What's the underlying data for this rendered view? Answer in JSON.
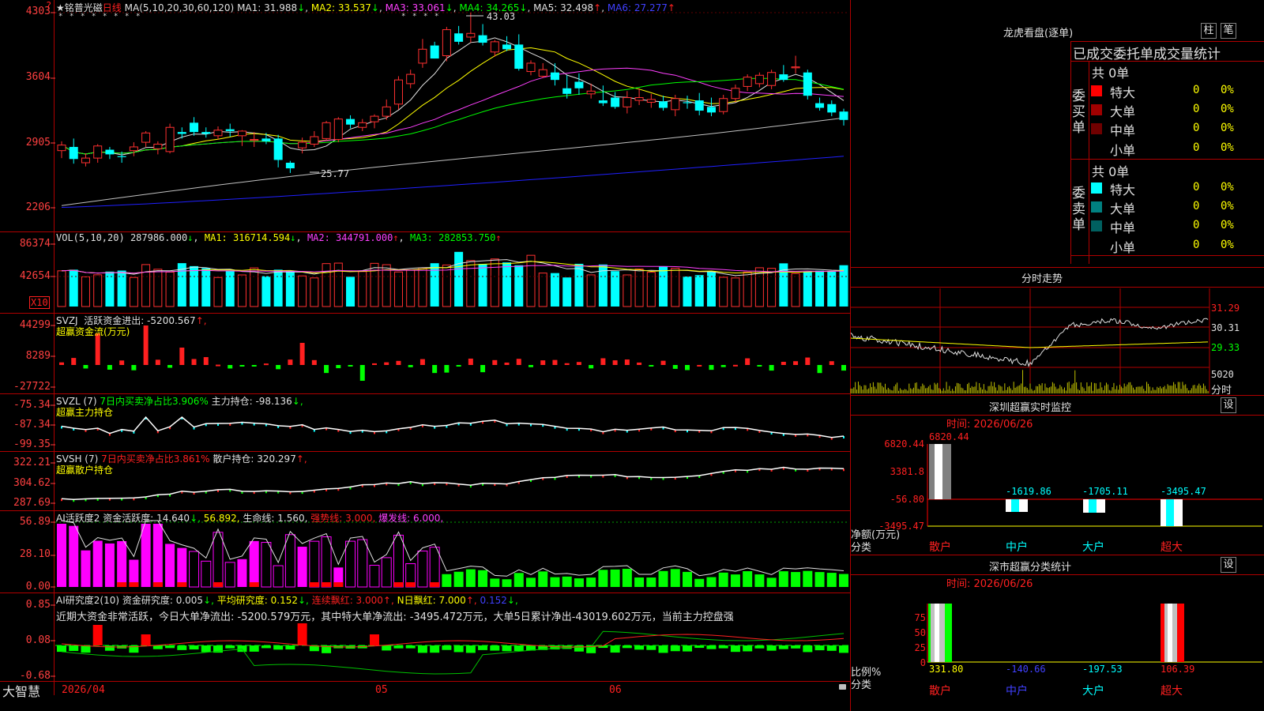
{
  "kline": {
    "star": "★",
    "stock_name": "铭普光磁",
    "period": "日线",
    "ma_params": "MA(5,10,20,30,60,120)",
    "ma1": "MA1: 31.988",
    "ma1_arrow": "↓",
    "ma2": "MA2: 33.537",
    "ma2_arrow": "↓",
    "ma3": "MA3: 33.061",
    "ma3_arrow": "↓",
    "ma4": "MA4: 34.265",
    "ma4_arrow": "↓",
    "ma5": "MA5: 32.498",
    "ma5_arrow": "↑",
    "ma6": "MA6: 27.277",
    "ma6_arrow": "↑",
    "high_mark": "43.03",
    "low_mark": "25.77",
    "y_labels": [
      "4303",
      "3604",
      "2905",
      "2206"
    ],
    "question_mark": "?"
  },
  "vol": {
    "title": "VOL(5,10,20)",
    "value": "287986.000",
    "value_arrow": "↓",
    "ma1": "MA1: 316714.594",
    "ma1_arrow": "↓",
    "ma2": "MA2: 344791.000",
    "ma2_arrow": "↑",
    "ma3": "MA3: 282853.750",
    "ma3_arrow": "↑",
    "y_labels": [
      "86374",
      "42654"
    ],
    "unit": "X10"
  },
  "svzj": {
    "title": "SVZJ",
    "label": "活跃资金进出: -5200.567",
    "arrow": "↑,",
    "subtitle": "超赢资金流(万元)",
    "y_labels": [
      "44299",
      "8289",
      "-27722"
    ]
  },
  "svzl": {
    "title": "SVZL (7)",
    "part1": "7日内买卖净占比3.906%",
    "part2": "主力持仓: -98.136",
    "arrow": "↓,",
    "subtitle": "超赢主力持仓",
    "y_labels": [
      "-75.34",
      "-87.34",
      "-99.35"
    ]
  },
  "svsh": {
    "title": "SVSH (7)",
    "part1": "7日内买卖净占比3.861%",
    "part2": "散户持仓: 320.297",
    "arrow": "↑,",
    "subtitle": "超赢散户持仓",
    "y_labels": [
      "322.21",
      "304.62",
      "287.69"
    ]
  },
  "ai_active": {
    "title": "AI活跃度2",
    "part1": "资金活跃度: 14.640",
    "arrow1": "↓,",
    "part2": "56.892,",
    "part3": "生命线: 1.560,",
    "part4": "强势线: 3.000,",
    "part5": "爆发线: 6.000,",
    "y_labels": [
      "56.89",
      "28.10",
      "0.00"
    ]
  },
  "ai_research": {
    "title": "AI研究度2(10)",
    "part1": "资金研究度: 0.005",
    "arrow1": "↓,",
    "part2": "平均研究度: 0.152",
    "arrow2": "↓,",
    "part3": "连续飘红: 3.000",
    "arrow3": "↑,",
    "part4": "N日飘红: 7.000",
    "arrow4": "↑,",
    "part5": "0.152",
    "arrow5": "↓,",
    "comment": "近期大资金非常活跃，今日大单净流出: -5200.579万元，其中特大单净流出: -3495.472万元，大单5日累计净出-43019.602万元，当前主力控盘强",
    "y_labels": [
      "0.85",
      "0.08",
      "-0.68"
    ]
  },
  "date_axis": {
    "app_name": "大智慧",
    "labels": [
      "2026/04",
      "05",
      "06"
    ]
  },
  "dragon": {
    "title": "龙虎看盘(逐单)",
    "btn_bar": "柱",
    "btn_pen": "笔",
    "header": "已成交委托单成交量统计",
    "buy_label": "委买单",
    "sell_label": "委卖单",
    "buy_total": "共 0单",
    "sell_total": "共 0单",
    "rows": [
      "特大",
      "大单",
      "中单",
      "小单"
    ],
    "zero": "0",
    "pct": "0%",
    "buy_colors": [
      "#ff0000",
      "#a00000",
      "#700000",
      ""
    ],
    "sell_colors": [
      "#00ffff",
      "#008080",
      "#006060",
      ""
    ]
  },
  "fenshi": {
    "title": "分时走势",
    "prices": [
      "31.29",
      "30.31",
      "29.33"
    ],
    "vol_label": "5020",
    "vol_unit": "分时"
  },
  "sz_monitor": {
    "title": "深圳超赢实时监控",
    "btn": "设",
    "time": "时间: 2026/06/26",
    "y_labels": [
      "6820.44",
      "3381.8",
      "-56.80",
      "-3495.47"
    ],
    "unit_label": "净额(万元)",
    "cat_label": "分类",
    "bars": [
      {
        "name": "散户",
        "value": "6820.44"
      },
      {
        "name": "中户",
        "value": "-1619.86"
      },
      {
        "name": "大户",
        "value": "-1705.11"
      },
      {
        "name": "超大",
        "value": "-3495.47"
      }
    ]
  },
  "sz_class": {
    "title": "深市超赢分类统计",
    "btn": "设",
    "time": "时间: 2026/06/26",
    "y_labels": [
      "75",
      "50",
      "25",
      "0"
    ],
    "unit_label": "比例%",
    "cat_label": "分类",
    "bars": [
      {
        "name": "散户",
        "value": "331.80",
        "pct": 100
      },
      {
        "name": "中户",
        "value": "-140.66",
        "pct": 0
      },
      {
        "name": "大户",
        "value": "-197.53",
        "pct": 0
      },
      {
        "name": "超大",
        "value": "106.39",
        "pct": 100
      }
    ]
  },
  "chart_data": [
    {
      "type": "candlestick",
      "title": "铭普光磁 日线",
      "ylim": [
        22.06,
        43.03
      ],
      "y_ticks": [
        43.03,
        36.04,
        29.05,
        22.06
      ],
      "ohlc": [
        [
          28.2,
          29.2,
          27.4,
          28.8
        ],
        [
          28.6,
          29.5,
          26.8,
          27.3
        ],
        [
          26.9,
          27.9,
          26.5,
          27.4
        ],
        [
          27.4,
          28.9,
          26.9,
          28.7
        ],
        [
          28.3,
          28.6,
          27.3,
          27.8
        ],
        [
          27.6,
          28.1,
          26.9,
          27.5
        ],
        [
          28.2,
          29.1,
          27.6,
          28.6
        ],
        [
          29.1,
          30.3,
          28.6,
          30.1
        ],
        [
          28.4,
          29.2,
          27.8,
          28.9
        ],
        [
          28.1,
          31.1,
          27.9,
          30.7
        ],
        [
          30.2,
          30.7,
          29.5,
          30.0
        ],
        [
          31.2,
          31.8,
          29.8,
          30.2
        ],
        [
          30.2,
          30.7,
          29.6,
          30.0
        ],
        [
          29.8,
          30.8,
          29.4,
          30.4
        ],
        [
          30.5,
          31.1,
          29.7,
          30.3
        ],
        [
          29.8,
          30.4,
          28.7,
          30.3
        ],
        [
          29.3,
          30.2,
          28.6,
          29.4
        ],
        [
          29.5,
          30.1,
          28.9,
          29.2
        ],
        [
          29.5,
          29.9,
          26.4,
          27.2
        ],
        [
          26.9,
          27.1,
          25.8,
          26.3
        ],
        [
          28.5,
          29.6,
          27.9,
          29.1
        ],
        [
          28.9,
          30.3,
          28.6,
          29.7
        ],
        [
          29.5,
          31.4,
          29.3,
          31.2
        ],
        [
          29.4,
          31.8,
          29.1,
          31.6
        ],
        [
          31.6,
          32.0,
          30.6,
          31.0
        ],
        [
          30.7,
          31.6,
          30.3,
          31.2
        ],
        [
          31.3,
          32.1,
          30.6,
          31.9
        ],
        [
          31.9,
          33.7,
          31.5,
          32.9
        ],
        [
          33.2,
          36.2,
          32.6,
          35.8
        ],
        [
          35.4,
          36.9,
          34.9,
          36.4
        ],
        [
          37.6,
          40.2,
          37.1,
          39.1
        ],
        [
          39.5,
          39.9,
          38.1,
          38.1
        ],
        [
          38.4,
          41.5,
          37.8,
          41.2
        ],
        [
          40.8,
          41.6,
          39.6,
          39.9
        ],
        [
          40.4,
          43.03,
          39.8,
          40.8
        ],
        [
          40.6,
          41.8,
          39.5,
          39.8
        ],
        [
          38.8,
          40.1,
          38.3,
          39.9
        ],
        [
          39.6,
          40.5,
          38.9,
          39.1
        ],
        [
          39.6,
          40.7,
          36.8,
          37.0
        ],
        [
          36.7,
          37.9,
          36.3,
          37.6
        ],
        [
          36.2,
          37.6,
          36.0,
          36.9
        ],
        [
          36.6,
          37.6,
          35.2,
          35.8
        ],
        [
          34.9,
          36.3,
          33.8,
          34.3
        ],
        [
          35.6,
          36.5,
          34.2,
          34.9
        ],
        [
          34.3,
          35.4,
          33.8,
          34.6
        ],
        [
          33.6,
          35.2,
          33.0,
          33.3
        ],
        [
          33.9,
          34.5,
          32.7,
          32.9
        ],
        [
          32.9,
          34.6,
          32.2,
          33.9
        ],
        [
          33.6,
          34.9,
          33.1,
          33.9
        ],
        [
          33.4,
          34.3,
          32.8,
          33.7
        ],
        [
          33.5,
          34.1,
          32.5,
          32.8
        ],
        [
          32.6,
          34.2,
          31.9,
          33.8
        ],
        [
          33.4,
          34.1,
          32.7,
          33.3
        ],
        [
          33.6,
          34.4,
          32.0,
          32.5
        ],
        [
          32.9,
          33.9,
          31.9,
          32.3
        ],
        [
          32.4,
          34.2,
          32.1,
          33.8
        ],
        [
          33.8,
          35.3,
          33.4,
          34.9
        ],
        [
          35.1,
          36.4,
          34.6,
          36.1
        ],
        [
          35.4,
          36.6,
          35.0,
          36.3
        ],
        [
          35.2,
          36.9,
          34.8,
          36.6
        ],
        [
          36.4,
          37.4,
          35.6,
          35.8
        ],
        [
          37.1,
          38.4,
          36.5,
          37.2
        ],
        [
          36.6,
          36.9,
          33.7,
          34.1
        ],
        [
          33.3,
          33.9,
          32.5,
          32.8
        ],
        [
          33.2,
          33.6,
          31.9,
          32.3
        ],
        [
          32.4,
          32.7,
          30.9,
          31.5
        ]
      ]
    }
  ]
}
